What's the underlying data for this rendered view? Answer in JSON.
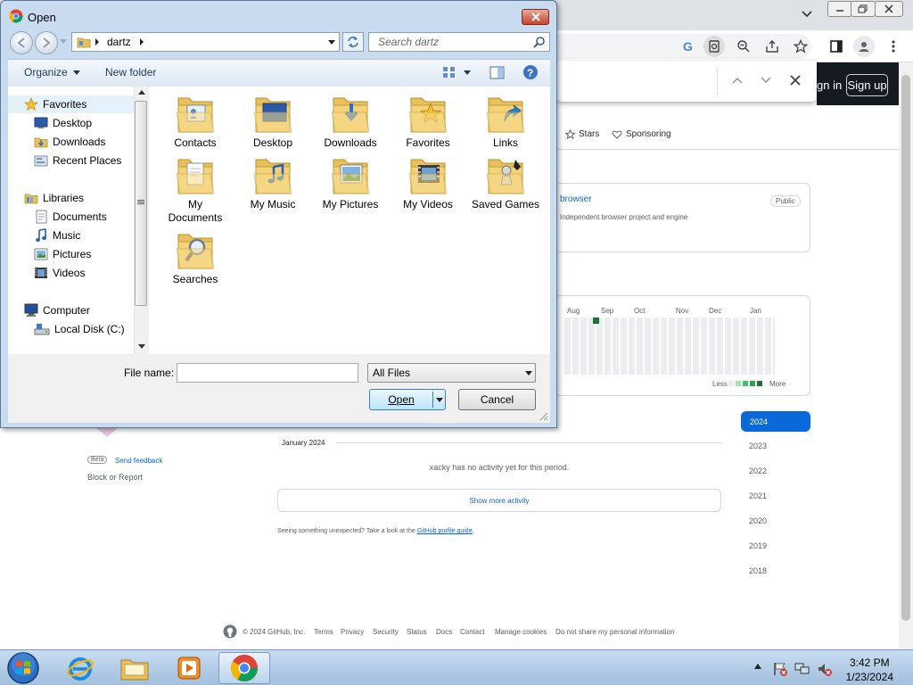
{
  "dialog": {
    "title": "Open",
    "address_crumb": "dartz",
    "search_placeholder": "Search dartz",
    "organize_label": "Organize",
    "new_folder_label": "New folder",
    "nav": {
      "favorites": "Favorites",
      "desktop": "Desktop",
      "downloads": "Downloads",
      "recent_places": "Recent Places",
      "libraries": "Libraries",
      "documents": "Documents",
      "music": "Music",
      "pictures": "Pictures",
      "videos": "Videos",
      "computer": "Computer",
      "local_disk": "Local Disk (C:)"
    },
    "items": {
      "contacts": "Contacts",
      "desktop": "Desktop",
      "downloads": "Downloads",
      "favorites": "Favorites",
      "links": "Links",
      "my_documents": "My Documents",
      "my_music": "My Music",
      "my_pictures": "My Pictures",
      "my_videos": "My Videos",
      "saved_games": "Saved Games",
      "searches": "Searches"
    },
    "file_name_label": "File name:",
    "file_name_value": "",
    "file_type": "All Files",
    "open_label": "Open",
    "cancel_label": "Cancel"
  },
  "browser": {
    "gh_signin": "gn in",
    "gh_signup": "Sign up",
    "stars_tab": "Stars",
    "sponsoring_tab": "Sponsoring",
    "repo_name": "browser",
    "repo_badge": "Public",
    "repo_desc": "Independent browser project and engine",
    "months": [
      "Aug",
      "Sep",
      "Oct",
      "Nov",
      "Dec",
      "Jan"
    ],
    "legend_less": "Less",
    "legend_more": "More",
    "years": [
      "2024",
      "2023",
      "2022",
      "2021",
      "2020",
      "2019",
      "2018"
    ],
    "period_label": "January 2024",
    "no_activity": "xacky has no activity yet for this period.",
    "show_more": "Show more activity",
    "unexpected_text": "Seeing something unexpected? Take a look at the",
    "profile_guide": "GitHub profile guide",
    "beta": "Beta",
    "send_feedback": "Send feedback",
    "block_report": "Block or Report",
    "footer": {
      "copyright": "© 2024 GitHub, Inc.",
      "terms": "Terms",
      "privacy": "Privacy",
      "security": "Security",
      "status": "Status",
      "docs": "Docs",
      "contact": "Contact",
      "manage_cookies": "Manage cookies",
      "do_not_share": "Do not share my personal information"
    }
  },
  "taskbar": {
    "time": "3:42 PM",
    "date": "1/23/2024"
  },
  "colors": {
    "github_blue": "#0969da",
    "github_dark": "#161b22",
    "dialog_frame": "#c9dcef",
    "folder_yellow": "#f3d27a"
  }
}
